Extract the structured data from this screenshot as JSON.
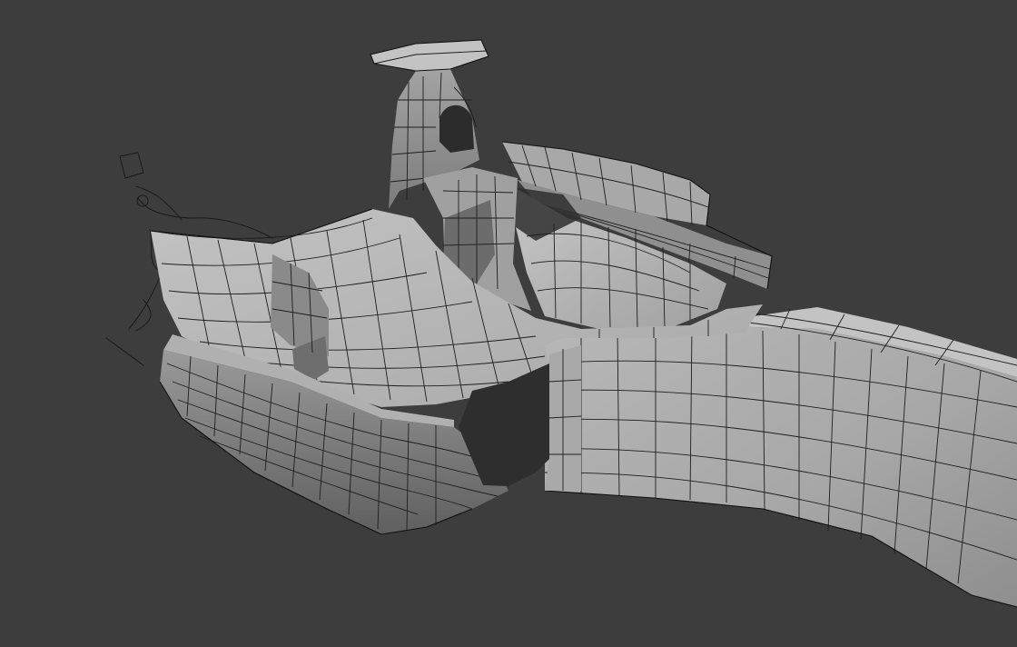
{
  "viewport": {
    "mode": "3d-viewport",
    "shading": "solid",
    "overlay": "wireframe",
    "background_color": "#3d3d3d"
  },
  "scene": {
    "objects": [
      {
        "name": "race-car-body",
        "type": "mesh"
      },
      {
        "name": "reference-sketch",
        "type": "annotation-stroke"
      }
    ]
  },
  "colors": {
    "mesh_light": "#b9b9b9",
    "mesh_mid": "#9c9c9c",
    "mesh_dark": "#6f6f6f",
    "wire": "#1e1e1e"
  }
}
